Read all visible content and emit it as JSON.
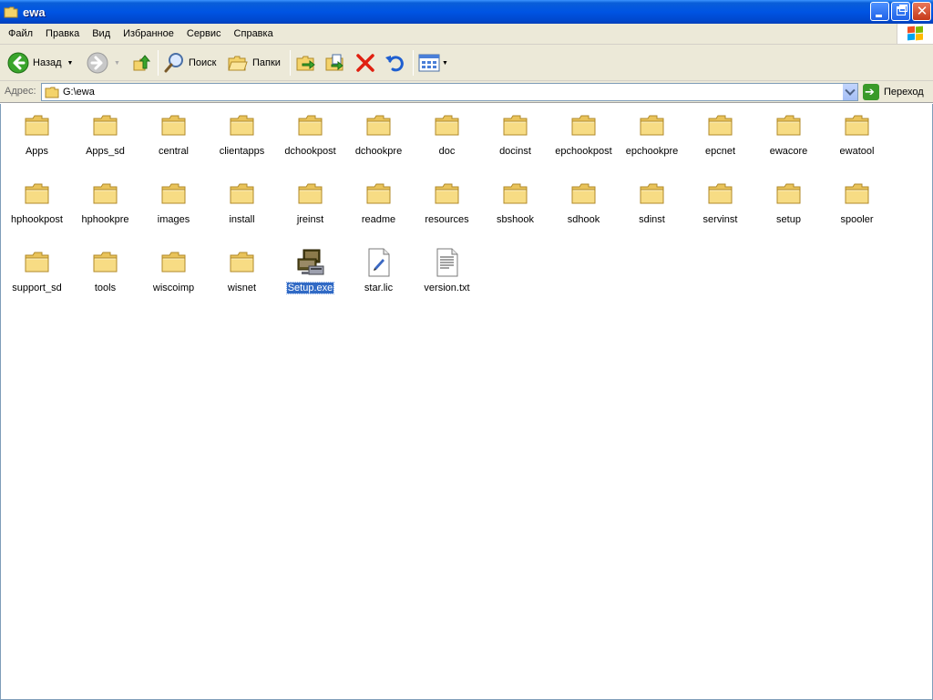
{
  "window": {
    "title": "ewa"
  },
  "menu": [
    "Файл",
    "Правка",
    "Вид",
    "Избранное",
    "Сервис",
    "Справка"
  ],
  "toolbar": {
    "back_label": "Назад",
    "search_label": "Поиск",
    "folders_label": "Папки"
  },
  "address": {
    "label": "Адрес:",
    "value": "G:\\ewa",
    "go_label": "Переход"
  },
  "items": [
    {
      "name": "Apps",
      "type": "folder"
    },
    {
      "name": "Apps_sd",
      "type": "folder"
    },
    {
      "name": "central",
      "type": "folder"
    },
    {
      "name": "clientapps",
      "type": "folder"
    },
    {
      "name": "dchookpost",
      "type": "folder"
    },
    {
      "name": "dchookpre",
      "type": "folder"
    },
    {
      "name": "doc",
      "type": "folder"
    },
    {
      "name": "docinst",
      "type": "folder"
    },
    {
      "name": "epchookpost",
      "type": "folder"
    },
    {
      "name": "epchookpre",
      "type": "folder"
    },
    {
      "name": "epcnet",
      "type": "folder"
    },
    {
      "name": "ewacore",
      "type": "folder"
    },
    {
      "name": "ewatool",
      "type": "folder"
    },
    {
      "name": "hphookpost",
      "type": "folder"
    },
    {
      "name": "hphookpre",
      "type": "folder"
    },
    {
      "name": "images",
      "type": "folder"
    },
    {
      "name": "install",
      "type": "folder"
    },
    {
      "name": "jreinst",
      "type": "folder"
    },
    {
      "name": "readme",
      "type": "folder"
    },
    {
      "name": "resources",
      "type": "folder"
    },
    {
      "name": "sbshook",
      "type": "folder"
    },
    {
      "name": "sdhook",
      "type": "folder"
    },
    {
      "name": "sdinst",
      "type": "folder"
    },
    {
      "name": "servinst",
      "type": "folder"
    },
    {
      "name": "setup",
      "type": "folder"
    },
    {
      "name": "spooler",
      "type": "folder"
    },
    {
      "name": "support_sd",
      "type": "folder"
    },
    {
      "name": "tools",
      "type": "folder"
    },
    {
      "name": "wiscoimp",
      "type": "folder"
    },
    {
      "name": "wisnet",
      "type": "folder"
    },
    {
      "name": "Setup.exe",
      "type": "exe",
      "selected": true
    },
    {
      "name": "star.lic",
      "type": "lic"
    },
    {
      "name": "version.txt",
      "type": "txt"
    }
  ],
  "colors": {
    "title_bar": "#0054e3",
    "selection": "#316ac5",
    "folder": "#f5d779"
  }
}
